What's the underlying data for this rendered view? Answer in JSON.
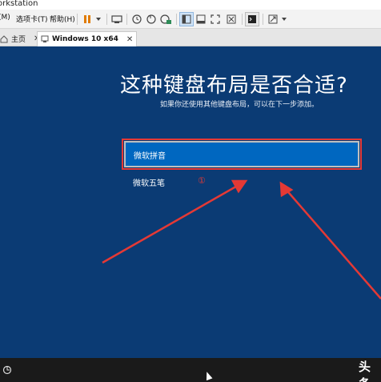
{
  "window": {
    "title": "orkstation"
  },
  "menu": {
    "items": [
      {
        "label": "(M)"
      },
      {
        "label": "选项卡(T)"
      },
      {
        "label": "帮助(H)"
      }
    ]
  },
  "toolbar": {
    "icons": [
      "pause-icon",
      "dropdown-icon",
      "send-keys-icon",
      "snapshot-icon",
      "revert-snapshot-icon",
      "snapshot-manager-icon",
      "sidebar-icon",
      "thumbnail-icon",
      "fullscreen-icon",
      "unity-icon",
      "console-icon",
      "stretch-icon"
    ]
  },
  "tabs": [
    {
      "label": "主页"
    },
    {
      "label": "Windows 10 x64"
    }
  ],
  "vm": {
    "heading": "这种键盘布局是否合适?",
    "subtext": "如果你还使用其他键盘布局，可以在下一步添加。",
    "options": [
      {
        "label": "微软拼音",
        "selected": true
      },
      {
        "label": "微软五笔",
        "selected": false
      }
    ],
    "annotation": "①"
  },
  "bottom": {
    "watermark": "头条"
  },
  "colors": {
    "vm_background": "#0b3b74",
    "selected_item": "#0067c0",
    "annotation_red": "#e53935"
  }
}
